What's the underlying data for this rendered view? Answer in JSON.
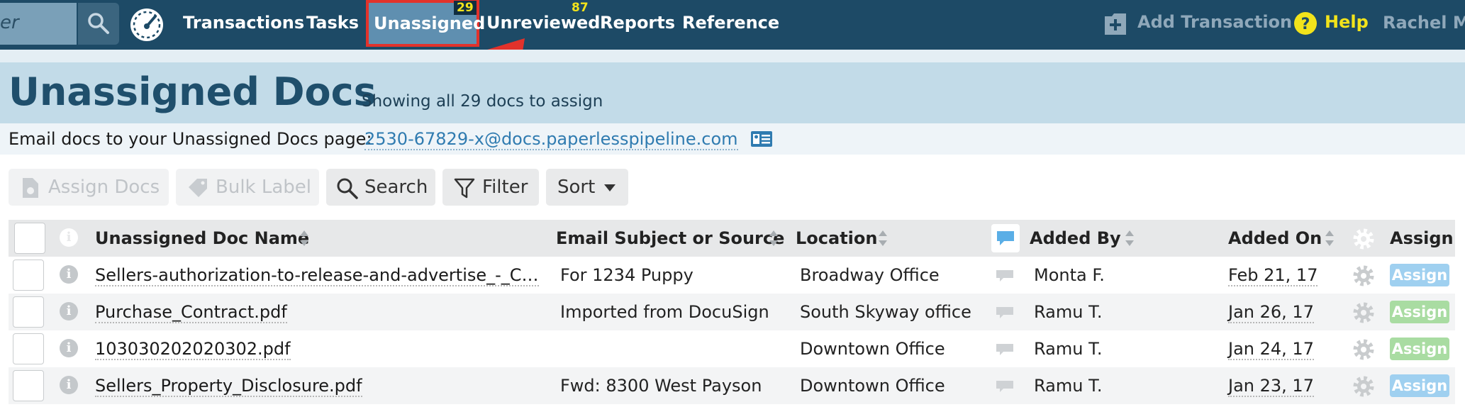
{
  "nav": {
    "search_partial": "er",
    "items": [
      {
        "label": "Transactions"
      },
      {
        "label": "Tasks"
      },
      {
        "label": "Unassigned",
        "badge": "29"
      },
      {
        "label": "Unreviewed",
        "badge": "87"
      },
      {
        "label": "Reports"
      },
      {
        "label": "Reference"
      }
    ],
    "add_transaction": "Add Transaction",
    "help": "Help",
    "user": "Rachel M."
  },
  "header": {
    "title": "Unassigned Docs",
    "count_text": "Showing all 29 docs to assign"
  },
  "email": {
    "label": "Email docs to your Unassigned Docs page:",
    "address": "2530-67829-x@docs.paperlesspipeline.com"
  },
  "toolbar": {
    "assign_docs": "Assign Docs",
    "bulk_label": "Bulk Label",
    "search": "Search",
    "filter": "Filter",
    "sort": "Sort"
  },
  "table": {
    "columns": {
      "doc_name": "Unassigned Doc Name",
      "email_subject": "Email Subject or Source",
      "location": "Location",
      "added_by": "Added By",
      "added_on": "Added On",
      "assign": "Assign"
    },
    "rows": [
      {
        "doc_name": "Sellers-authorization-to-release-and-advertise_-_C…",
        "subject": "For 1234 Puppy",
        "location": "Broadway Office",
        "added_by": "Monta F.",
        "added_on": "Feb 21, 17",
        "action": "Assign"
      },
      {
        "doc_name": "Purchase_Contract.pdf",
        "subject": "Imported from DocuSign",
        "location": "South Skyway office",
        "added_by": "Ramu T.",
        "added_on": "Jan 26, 17",
        "action": "Assign"
      },
      {
        "doc_name": "103030202020302.pdf",
        "subject": "",
        "location": "Downtown Office",
        "added_by": "Ramu T.",
        "added_on": "Jan 24, 17",
        "action": "Assign"
      },
      {
        "doc_name": "Sellers_Property_Disclosure.pdf",
        "subject": "Fwd: 8300 West Payson",
        "location": "Downtown Office",
        "added_by": "Ramu T.",
        "added_on": "Jan 23, 17",
        "action": "Assign"
      }
    ]
  },
  "colors": {
    "nav_bg": "#1d4a66",
    "header_bg": "#c2dbe8",
    "highlight": "#e2322b",
    "badge": "#f2e31b",
    "assign_blue": "#9fd0f0",
    "assign_green": "#a9dca2"
  }
}
